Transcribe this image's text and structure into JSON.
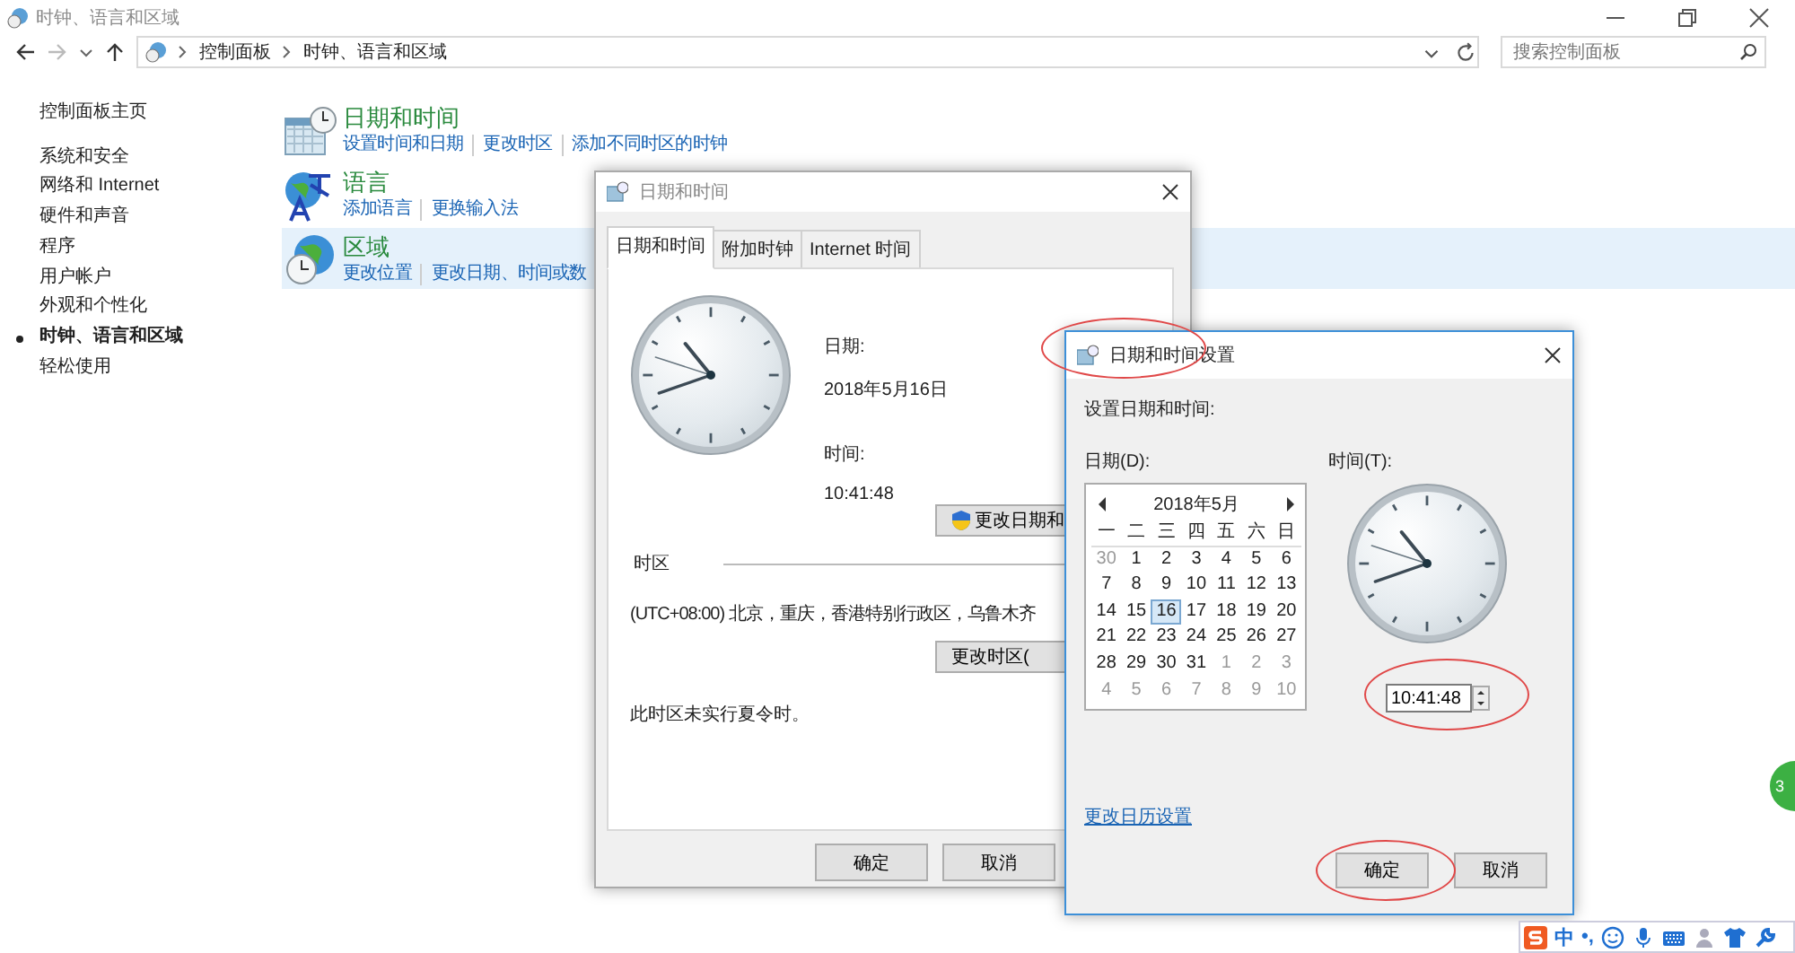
{
  "window": {
    "title": "时钟、语言和区域"
  },
  "address_bar": {
    "breadcrumbs": [
      "控制面板",
      "时钟、语言和区域"
    ]
  },
  "search": {
    "placeholder": "搜索控制面板"
  },
  "sidebar": {
    "items": [
      {
        "label": "控制面板主页",
        "selected": false
      },
      {
        "label": "系统和安全",
        "selected": false
      },
      {
        "label": "网络和 Internet",
        "selected": false
      },
      {
        "label": "硬件和声音",
        "selected": false
      },
      {
        "label": "程序",
        "selected": false
      },
      {
        "label": "用户帐户",
        "selected": false
      },
      {
        "label": "外观和个性化",
        "selected": false
      },
      {
        "label": "时钟、语言和区域",
        "selected": true
      },
      {
        "label": "轻松使用",
        "selected": false
      }
    ]
  },
  "categories": [
    {
      "kind": "datetime",
      "title": "日期和时间",
      "selected": false,
      "links": [
        "设置时间和日期",
        "更改时区",
        "添加不同时区的时钟"
      ]
    },
    {
      "kind": "language",
      "title": "语言",
      "selected": false,
      "links": [
        "添加语言",
        "更换输入法"
      ]
    },
    {
      "kind": "region",
      "title": "区域",
      "selected": true,
      "links": [
        "更改位置",
        "更改日期、时间或数"
      ]
    }
  ],
  "dialog_datetime": {
    "title": "日期和时间",
    "tabs": [
      {
        "label": "日期和时间",
        "selected": true
      },
      {
        "label": "附加时钟",
        "selected": false
      },
      {
        "label": "Internet 时间",
        "selected": false
      }
    ],
    "date_label": "日期:",
    "date": "2018年5月16日",
    "time_label": "时间:",
    "time": "10:41:48",
    "change_button": "更改日期和",
    "timezone_heading": "时区",
    "timezone": "(UTC+08:00) 北京，重庆，香港特别行政区，乌鲁木齐",
    "timezone_button": "更改时区(",
    "dst_note": "此时区未实行夏令时。",
    "buttons": [
      "确定",
      "取消"
    ]
  },
  "dialog_settings": {
    "title": "日期和时间设置",
    "heading": "设置日期和时间:",
    "date_label": "日期(D):",
    "time_label": "时间(T):",
    "calendar": {
      "month": "2018年5月",
      "weekdays": [
        "一",
        "二",
        "三",
        "四",
        "五",
        "六",
        "日"
      ],
      "days": [
        {
          "label": "30",
          "other_month": true,
          "selected": false
        },
        {
          "label": "1",
          "other_month": false,
          "selected": false
        },
        {
          "label": "2",
          "other_month": false,
          "selected": false
        },
        {
          "label": "3",
          "other_month": false,
          "selected": false
        },
        {
          "label": "4",
          "other_month": false,
          "selected": false
        },
        {
          "label": "5",
          "other_month": false,
          "selected": false
        },
        {
          "label": "6",
          "other_month": false,
          "selected": false
        },
        {
          "label": "7",
          "other_month": false,
          "selected": false
        },
        {
          "label": "8",
          "other_month": false,
          "selected": false
        },
        {
          "label": "9",
          "other_month": false,
          "selected": false
        },
        {
          "label": "10",
          "other_month": false,
          "selected": false
        },
        {
          "label": "11",
          "other_month": false,
          "selected": false
        },
        {
          "label": "12",
          "other_month": false,
          "selected": false
        },
        {
          "label": "13",
          "other_month": false,
          "selected": false
        },
        {
          "label": "14",
          "other_month": false,
          "selected": false
        },
        {
          "label": "15",
          "other_month": false,
          "selected": false
        },
        {
          "label": "16",
          "other_month": false,
          "selected": true
        },
        {
          "label": "17",
          "other_month": false,
          "selected": false
        },
        {
          "label": "18",
          "other_month": false,
          "selected": false
        },
        {
          "label": "19",
          "other_month": false,
          "selected": false
        },
        {
          "label": "20",
          "other_month": false,
          "selected": false
        },
        {
          "label": "21",
          "other_month": false,
          "selected": false
        },
        {
          "label": "22",
          "other_month": false,
          "selected": false
        },
        {
          "label": "23",
          "other_month": false,
          "selected": false
        },
        {
          "label": "24",
          "other_month": false,
          "selected": false
        },
        {
          "label": "25",
          "other_month": false,
          "selected": false
        },
        {
          "label": "26",
          "other_month": false,
          "selected": false
        },
        {
          "label": "27",
          "other_month": false,
          "selected": false
        },
        {
          "label": "28",
          "other_month": false,
          "selected": false
        },
        {
          "label": "29",
          "other_month": false,
          "selected": false
        },
        {
          "label": "30",
          "other_month": false,
          "selected": false
        },
        {
          "label": "31",
          "other_month": false,
          "selected": false
        },
        {
          "label": "1",
          "other_month": true,
          "selected": false
        },
        {
          "label": "2",
          "other_month": true,
          "selected": false
        },
        {
          "label": "3",
          "other_month": true,
          "selected": false
        },
        {
          "label": "4",
          "other_month": true,
          "selected": false
        },
        {
          "label": "5",
          "other_month": true,
          "selected": false
        },
        {
          "label": "6",
          "other_month": true,
          "selected": false
        },
        {
          "label": "7",
          "other_month": true,
          "selected": false
        },
        {
          "label": "8",
          "other_month": true,
          "selected": false
        },
        {
          "label": "9",
          "other_month": true,
          "selected": false
        },
        {
          "label": "10",
          "other_month": true,
          "selected": false
        }
      ]
    },
    "time": "10:41:48",
    "calendar_link": "更改日历设置",
    "buttons": [
      "确定",
      "取消"
    ]
  },
  "ime_bar": {
    "mode": "中",
    "punctuation": "•,"
  },
  "side_badge": {
    "text": "3"
  }
}
